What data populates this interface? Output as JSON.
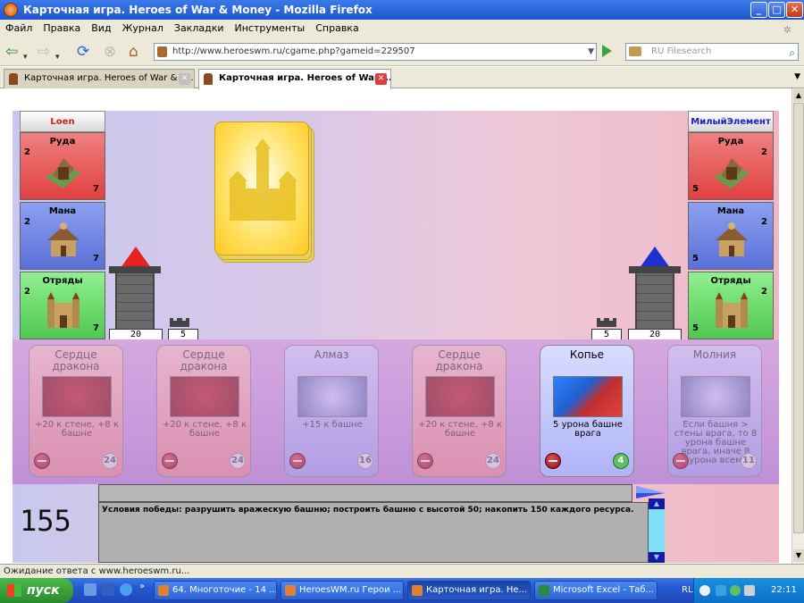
{
  "window": {
    "title": "Карточная игра. Heroes of War & Money - Mozilla Firefox",
    "min": "_",
    "max": "□",
    "close": "✕"
  },
  "menu": [
    "Файл",
    "Правка",
    "Вид",
    "Журнал",
    "Закладки",
    "Инструменты",
    "Справка"
  ],
  "nav": {
    "url": "http://www.heroeswm.ru/cgame.php?gameid=229507",
    "search_placeholder": "RU Filesearch"
  },
  "tabs": [
    {
      "label": "Карточная игра. Heroes of War & M..."
    },
    {
      "label": "Карточная игра. Heroes of War ..."
    }
  ],
  "game": {
    "left": {
      "name": "Loen",
      "resources": [
        {
          "name": "Руда",
          "income": "2",
          "amount": "7"
        },
        {
          "name": "Мана",
          "income": "2",
          "amount": "7"
        },
        {
          "name": "Отряды",
          "income": "2",
          "amount": "7"
        }
      ],
      "tower": "20",
      "wall": "5"
    },
    "right": {
      "name": "МилыйЭлемент",
      "resources": [
        {
          "name": "Руда",
          "income": "2",
          "amount": "5"
        },
        {
          "name": "Мана",
          "income": "2",
          "amount": "5"
        },
        {
          "name": "Отряды",
          "income": "2",
          "amount": "5"
        }
      ],
      "tower": "20",
      "wall": "5"
    },
    "cards": [
      {
        "title": "Сердце дракона",
        "desc": "+20 к стене, +8 к башне",
        "cost": "24",
        "color": "red"
      },
      {
        "title": "Сердце дракона",
        "desc": "+20 к стене, +8 к башне",
        "cost": "24",
        "color": "red"
      },
      {
        "title": "Алмаз",
        "desc": "+15 к башне",
        "cost": "16",
        "color": "blue"
      },
      {
        "title": "Сердце дракона",
        "desc": "+20 к стене, +8 к башне",
        "cost": "24",
        "color": "red"
      },
      {
        "title": "Копье",
        "desc": "5 урона башне врага",
        "cost": "4",
        "color": "blue"
      },
      {
        "title": "Молния",
        "desc": "Если башня > стены врага, то 8 урона башне врага, иначе 8 урона всем",
        "cost": "11",
        "color": "blue"
      }
    ],
    "counter": "155",
    "log": "Условия победы: разрушить вражескую башню; построить башню с высотой 50; накопить 150 каждого ресурса."
  },
  "status": "Ожидание ответа с www.heroeswm.ru...",
  "taskbar": {
    "start": "пуск",
    "tasks": [
      "64. Многоточие - 14 ...",
      "HeroesWM.ru Герои ...",
      "Карточная игра. Не...",
      "Microsoft Excel - Таб..."
    ],
    "lang": "RL",
    "clock": "22:11"
  }
}
